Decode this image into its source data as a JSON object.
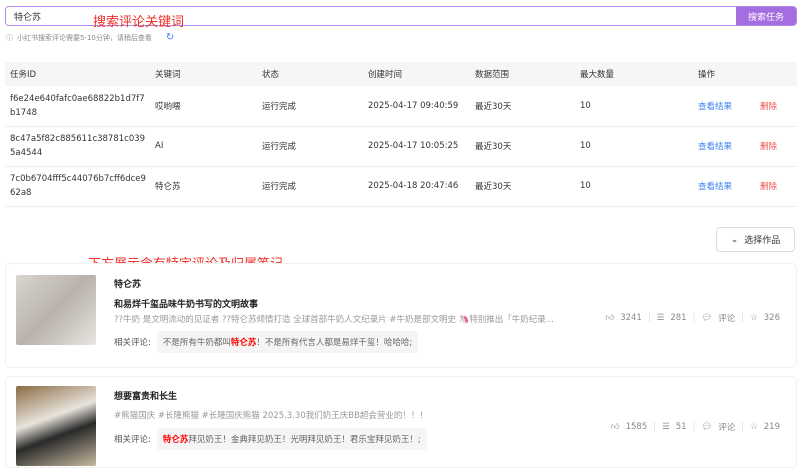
{
  "search": {
    "value": "特仑苏",
    "button": "搜索任务",
    "annotation": "搜索评论关键词"
  },
  "hint": "小红书搜索评论需要5-10分钟，请稍后查看",
  "table": {
    "headers": [
      "任务ID",
      "关键词",
      "状态",
      "创建时间",
      "数据范围",
      "最大数量",
      "操作"
    ],
    "rows": [
      {
        "id": "f6e24e640fafc0ae68822b1d7f7b1748",
        "keyword": "哎哟喂",
        "status": "运行完成",
        "created": "2025-04-17 09:40:59",
        "range": "最近30天",
        "max": "10",
        "view": "查看结果",
        "delete": "删除"
      },
      {
        "id": "8c47a5f82c885611c38781c0395a4544",
        "keyword": "AI",
        "status": "运行完成",
        "created": "2025-04-17 10:05:25",
        "range": "最近30天",
        "max": "10",
        "view": "查看结果",
        "delete": "删除"
      },
      {
        "id": "7c0b6704fff5c44076b7cff6dce962a8",
        "keyword": "特仑苏",
        "status": "运行完成",
        "created": "2025-04-18 20:47:46",
        "range": "最近30天",
        "max": "10",
        "view": "查看结果",
        "delete": "删除"
      }
    ]
  },
  "select_button": "选择作品",
  "results_annotation": "下方展示含有特定评论及归属笔记",
  "related_label": "相关评论:",
  "notes": [
    {
      "author": "特仑苏",
      "title": "和易烊千玺品味牛奶书写的文明故事",
      "desc": "??牛奶 是文明流动的见证者 ??特仑苏倾情打造 全球首部牛奶人文纪录片 #牛奶是部文明史 🦄特别推出「牛奶纪录...",
      "comment_pre": "不是所有牛奶都叫",
      "comment_hl": "特仑苏",
      "comment_post": "！不是所有代言人都是易烊千玺！哈哈哈;",
      "likes": "3241",
      "collects": "281",
      "comment_label": "评论",
      "stars": "326"
    },
    {
      "title": "想要富贵和长生",
      "desc": "#熊猫国庆 #长隆熊猫 #长隆国庆熊猫 2025.3.30我们奶王庆BB超会营业的！！！",
      "comment_pre": "",
      "comment_hl": "特仑苏",
      "comment_post": "拜见奶王！金典拜见奶王！光明拜见奶王！君乐宝拜见奶王！;",
      "likes": "1585",
      "collects": "51",
      "comment_label": "评论",
      "stars": "219"
    }
  ]
}
